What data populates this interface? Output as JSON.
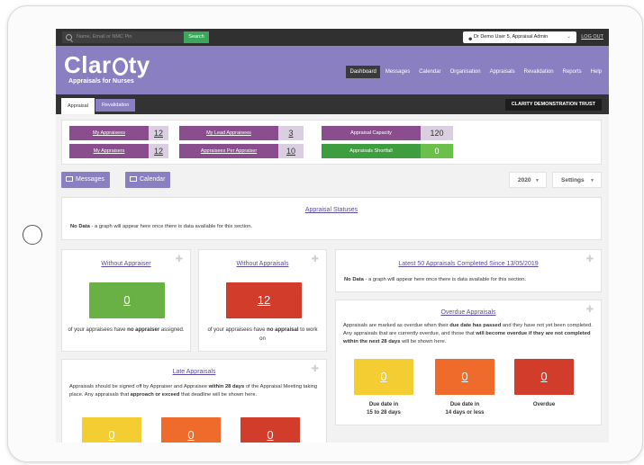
{
  "topbar": {
    "search_placeholder": "Name, Email or NMC Pin",
    "search_button": "Search",
    "user_label": "Dr Demo User 5, Appraisal Admin",
    "logout": "LOG OUT"
  },
  "brand": {
    "logo": "Clar",
    "logo_glyph": "i",
    "logo_end": "ty",
    "tagline": "Appraisals for Nurses"
  },
  "nav": [
    {
      "label": "Dashboard",
      "active": true
    },
    {
      "label": "Messages"
    },
    {
      "label": "Calendar"
    },
    {
      "label": "Organisation"
    },
    {
      "label": "Appraisals"
    },
    {
      "label": "Revalidation"
    },
    {
      "label": "Reports"
    },
    {
      "label": "Help"
    }
  ],
  "tabs": {
    "appraisal": "Appraisal",
    "revalidation": "Revalidation",
    "trust": "CLARITY DEMONSTRATION TRUST"
  },
  "stats": {
    "my_appraisees": {
      "label": "My Appraisees",
      "value": "12"
    },
    "my_appraisers": {
      "label": "My Appraisers",
      "value": "12"
    },
    "my_lead_appraisees": {
      "label": "My Lead Appraisees",
      "value": "3"
    },
    "appraisees_per_appraiser": {
      "label": "Appraisees Per Appraiser",
      "value": "10"
    },
    "appraisal_capacity": {
      "label": "Appraisal Capacity",
      "value": "120"
    },
    "appraisals_shortfall": {
      "label": "Appraisals Shortfall",
      "value": "0"
    }
  },
  "toolbar": {
    "messages": "Messages",
    "calendar": "Calendar",
    "year": "2020",
    "settings": "Settings"
  },
  "statuses": {
    "title": "Appraisal Statuses",
    "nodata_bold": "No Data",
    "nodata_text": " - a graph will appear here once there is data available for this section."
  },
  "without_appraiser": {
    "title": "Without Appraiser",
    "value": "0",
    "desc_pre": "of your appraisees have ",
    "desc_bold": "no appraiser",
    "desc_post": " assigned."
  },
  "without_appraisals": {
    "title": "Without Appraisals",
    "value": "12",
    "desc_pre": "of your appraisees have ",
    "desc_bold": "no appraisal",
    "desc_post": " to work on"
  },
  "latest50": {
    "title": "Latest 50 Appraisals Completed Since 13/05/2019",
    "nodata_bold": "No Data",
    "nodata_text": " - a graph will appear here once there is data available for this section."
  },
  "overdue": {
    "title": "Overdue Appraisals",
    "t1": "Appraisals are marked as overdue when their ",
    "t2": "due date has passed",
    "t3": " and they have not yet been completed. Any appraisals that are currently overdue, and those that ",
    "t4": "will become overdue if they are not completed within the next 28 days",
    "t5": " will be shown here.",
    "boxes": [
      {
        "value": "0",
        "label1": "Due date in",
        "label2": "15 to 28 days"
      },
      {
        "value": "0",
        "label1": "Due date in",
        "label2": "14 days or less"
      },
      {
        "value": "0",
        "label1": "Overdue",
        "label2": ""
      }
    ]
  },
  "late": {
    "title": "Late Appraisals",
    "t1": "Appraisals should be signed off by Appraiser and Appraisee ",
    "t2": "within 28 days",
    "t3": " of the Appraisal Meeting taking place. Any appraisals that ",
    "t4": "approach or exceed",
    "t5": " that deadline will be shown here.",
    "boxes": [
      {
        "value": "0"
      },
      {
        "value": "0"
      },
      {
        "value": "0"
      }
    ]
  },
  "colors": {
    "purple": "#8a7fc0",
    "plum": "#8a4d8e",
    "green": "#69b145",
    "red": "#d23c2a",
    "yellow": "#f4cd32",
    "orange": "#ee6b2c"
  }
}
